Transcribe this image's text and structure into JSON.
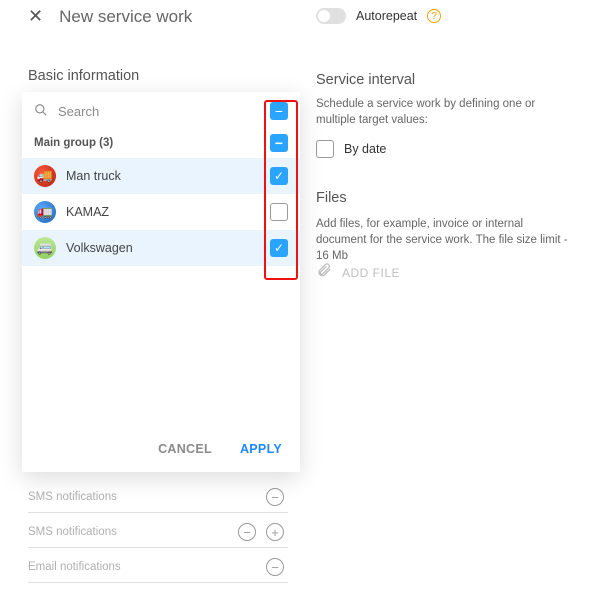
{
  "header": {
    "title": "New service work",
    "autorepeat_label": "Autorepeat"
  },
  "basic_info": {
    "heading": "Basic information"
  },
  "dropdown": {
    "search_placeholder": "Search",
    "group_label": "Main group (3)",
    "items": [
      {
        "label": "Man truck",
        "checked": true
      },
      {
        "label": "KAMAZ",
        "checked": false
      },
      {
        "label": "Volkswagen",
        "checked": true
      }
    ],
    "cancel": "CANCEL",
    "apply": "APPLY"
  },
  "service_interval": {
    "heading": "Service interval",
    "description": "Schedule a service work by defining one or multiple target values:",
    "by_date": "By date"
  },
  "files": {
    "heading": "Files",
    "description": "Add files, for example, invoice or internal document for the service work. The file size limit - 16 Mb",
    "add_file": "ADD FILE"
  },
  "dim_rows": {
    "sms1": "SMS notifications",
    "sms2": "SMS notifications",
    "email": "Email notifications"
  }
}
